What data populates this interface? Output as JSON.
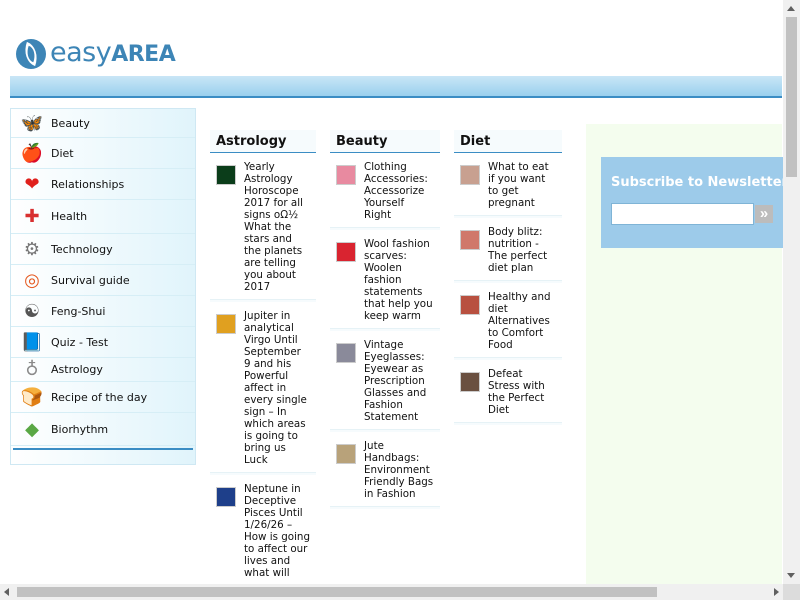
{
  "logo": {
    "part1": "easy",
    "part2": "AREA"
  },
  "sidebar": {
    "items": [
      {
        "label": "Beauty",
        "icon": "butterfly-icon",
        "glyph": "🦋",
        "color": "#b561d8"
      },
      {
        "label": "Diet",
        "icon": "apple-icon",
        "glyph": "🍎",
        "color": "#d8322c"
      },
      {
        "label": "Relationships",
        "icon": "heart-icon",
        "glyph": "❤",
        "color": "#e0201c"
      },
      {
        "label": "Health",
        "icon": "first-aid-icon",
        "glyph": "✚",
        "color": "#d83030"
      },
      {
        "label": "Technology",
        "icon": "gear-icon",
        "glyph": "⚙",
        "color": "#777777"
      },
      {
        "label": "Survival guide",
        "icon": "lifebuoy-icon",
        "glyph": "◎",
        "color": "#e5581f"
      },
      {
        "label": "Feng-Shui",
        "icon": "yin-yang-icon",
        "glyph": "☯",
        "color": "#555555"
      },
      {
        "label": "Quiz - Test",
        "icon": "book-icon",
        "glyph": "📘",
        "color": "#2a4d8c"
      },
      {
        "label": "Astrology",
        "icon": "ring-planet-icon",
        "glyph": "♁",
        "color": "#8a8a8a"
      },
      {
        "label": "Recipe of the day",
        "icon": "bread-icon",
        "glyph": "🍞",
        "color": "#d08a2c"
      },
      {
        "label": "Biorhythm",
        "icon": "cube-icon",
        "glyph": "◆",
        "color": "#5aa845"
      }
    ]
  },
  "columns": [
    {
      "title": "Astrology",
      "articles": [
        {
          "title": "Yearly Astrology Horoscope 2017 for all signs οΩ½ What the stars and the planets are telling you about 2017",
          "thumb_color": "#0b3d1a"
        },
        {
          "title": "Jupiter in analytical Virgo Until September 9 and his Powerful affect in every single sign – In which areas is going to bring us Luck",
          "thumb_color": "#e0a020"
        },
        {
          "title": "Neptune in Deceptive Pisces Until 1/26/26 – How is going to affect our lives and what will",
          "thumb_color": "#1e3f8a"
        }
      ]
    },
    {
      "title": "Beauty",
      "articles": [
        {
          "title": "Clothing Accessories: Accessorize Yourself Right",
          "thumb_color": "#e88aa0"
        },
        {
          "title": "Wool fashion scarves: Woolen fashion statements that help you keep warm",
          "thumb_color": "#d92430"
        },
        {
          "title": "Vintage Eyeglasses: Eyewear as Prescription Glasses and Fashion Statement",
          "thumb_color": "#8a8a9a"
        },
        {
          "title": "Jute Handbags: Environment Friendly Bags in Fashion",
          "thumb_color": "#b8a27a"
        }
      ]
    },
    {
      "title": "Diet",
      "articles": [
        {
          "title": "What to eat if you want to get pregnant",
          "thumb_color": "#c8a090"
        },
        {
          "title": "Body blitz: nutrition - The perfect diet plan",
          "thumb_color": "#d0786a"
        },
        {
          "title": "Healthy and diet Alternatives to Comfort Food",
          "thumb_color": "#b85040"
        },
        {
          "title": "Defeat Stress with the Perfect Diet",
          "thumb_color": "#6a5040"
        }
      ]
    }
  ],
  "newsletter": {
    "title": "Subscribe to Newsletter",
    "placeholder": "",
    "button": "»"
  }
}
